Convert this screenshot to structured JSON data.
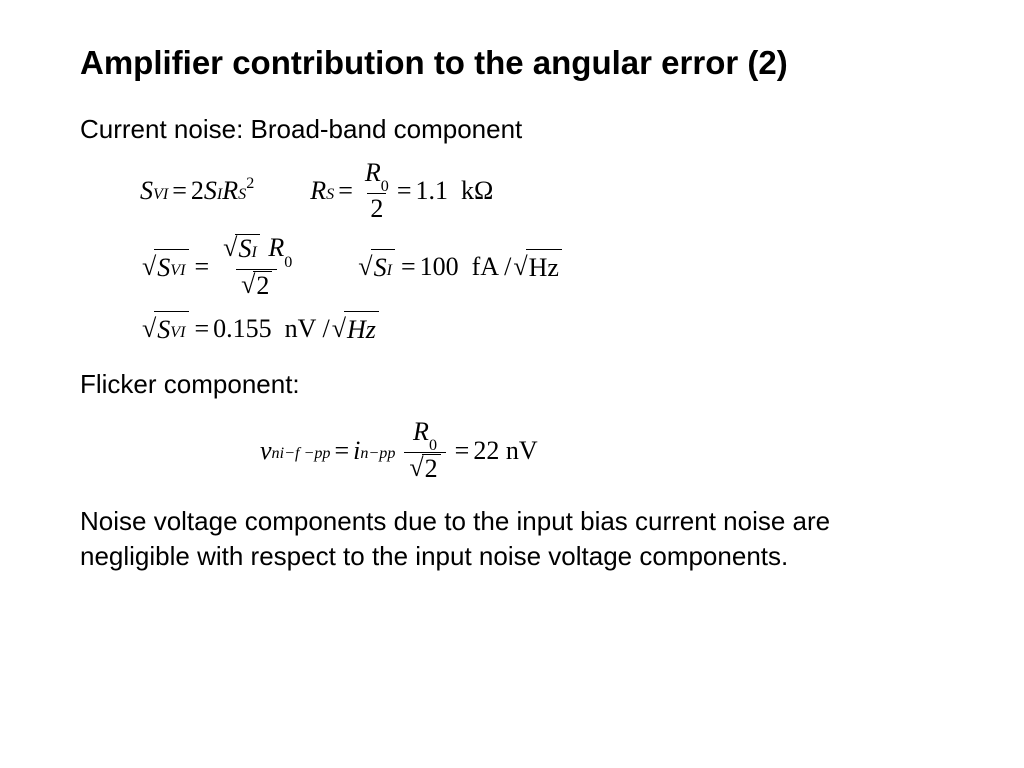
{
  "title": "Amplifier contribution to the angular error (2)",
  "section1": "Current noise: Broad-band component",
  "eq1": {
    "lhs_sym": "S",
    "lhs_sub": "VI",
    "rhs_coeff": "2",
    "rhs_sym": "S",
    "rhs_sub": "I",
    "rhs_sym2": "R",
    "rhs_sub2": "S",
    "rhs_sup2": "2"
  },
  "eq2": {
    "lhs_sym": "R",
    "lhs_sub": "S",
    "num_sym": "R",
    "num_sub": "0",
    "den": "2",
    "value": "1.1",
    "unit": "kΩ"
  },
  "eq3": {
    "sqrt_sym": "S",
    "sqrt_sub": "VI",
    "num_sqrt_sym": "S",
    "num_sqrt_sub": "I",
    "num_sym2": "R",
    "num_sub2": "0",
    "den_sqrt": "2"
  },
  "eq4": {
    "sqrt_sym": "S",
    "sqrt_sub": "I",
    "value": "100",
    "unit1": "fA /",
    "unit_sqrt": "Hz"
  },
  "eq5": {
    "sqrt_sym": "S",
    "sqrt_sub": "VI",
    "value": "0.155",
    "unit1": "nV /",
    "unit_sqrt": "Hz"
  },
  "section2": "Flicker component:",
  "eq6": {
    "lhs_sym": "v",
    "lhs_sub": "ni−f −pp",
    "rhs_sym": "i",
    "rhs_sub": "n−pp",
    "num_sym": "R",
    "num_sub": "0",
    "den_sqrt": "2",
    "value": "22",
    "unit": "nV"
  },
  "conclusion": "Noise voltage components due to the input bias current noise are negligible with respect to the input noise voltage components."
}
